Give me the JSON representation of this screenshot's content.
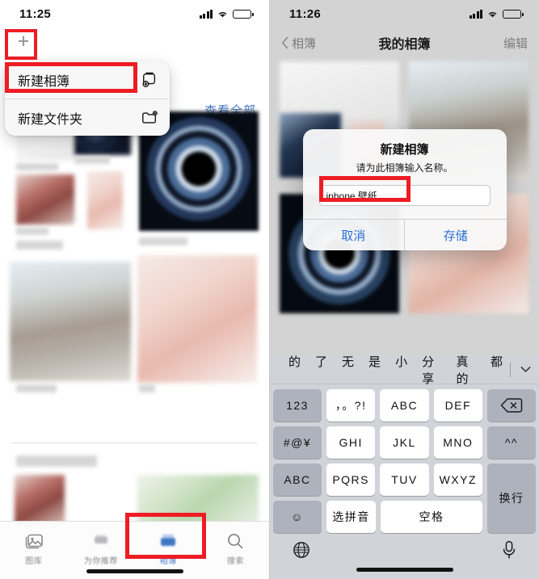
{
  "left": {
    "status": {
      "time": "11:25",
      "signal_icon": "cellular-signal-icon",
      "wifi_icon": "wifi-icon",
      "battery_icon": "battery-icon"
    },
    "add_button": {
      "label": "+",
      "name": "add-button"
    },
    "context_menu": {
      "items": [
        {
          "label": "新建相簿",
          "icon": "new-album-icon"
        },
        {
          "label": "新建文件夹",
          "icon": "new-folder-icon"
        }
      ]
    },
    "see_all_label": "查看全部",
    "tabbar": {
      "items": [
        {
          "label": "图库",
          "icon": "photos-icon",
          "active": false
        },
        {
          "label": "为你推荐",
          "icon": "for-you-icon",
          "active": false
        },
        {
          "label": "相簿",
          "icon": "albums-icon",
          "active": true
        },
        {
          "label": "搜索",
          "icon": "search-icon",
          "active": false
        }
      ]
    }
  },
  "right": {
    "status": {
      "time": "11:26",
      "signal_icon": "cellular-signal-icon",
      "wifi_icon": "wifi-icon",
      "battery_icon": "battery-icon"
    },
    "navbar": {
      "back_label": "相簿",
      "title": "我的相簿",
      "edit_label": "编辑",
      "back_icon": "chevron-left-icon"
    },
    "dialog": {
      "title": "新建相簿",
      "subtitle": "请为此相簿输入名称。",
      "input_value": "iphone 壁纸",
      "input_placeholder": "",
      "cancel_label": "取消",
      "save_label": "存储"
    },
    "keyboard": {
      "suggestions": [
        "的",
        "了",
        "无",
        "是",
        "小",
        "分享",
        "真的",
        "都"
      ],
      "collapse_icon": "chevron-down-icon",
      "rows": [
        {
          "left": "123",
          "keys": [
            "，。?!",
            "ABC",
            "DEF"
          ],
          "right": "delete-icon"
        },
        {
          "left": "#@¥",
          "keys": [
            "GHI",
            "JKL",
            "MNO"
          ],
          "right": "^^"
        },
        {
          "left": "ABC",
          "keys": [
            "PQRS",
            "TUV",
            "WXYZ"
          ],
          "right": "换行"
        },
        {
          "left": "emoji-icon",
          "keys": [
            "选拼音",
            "空格"
          ],
          "right": ""
        }
      ],
      "globe_icon": "globe-icon",
      "mic_icon": "microphone-icon",
      "return_label": "换行",
      "space_label": "空格",
      "pinyin_label": "选拼音",
      "symbols_label": "#@¥",
      "numbers_label": "123",
      "abc_label": "ABC",
      "emoji_label": "☺",
      "caret_label": "^^"
    }
  },
  "highlights": {
    "color": "#ee1c24"
  }
}
